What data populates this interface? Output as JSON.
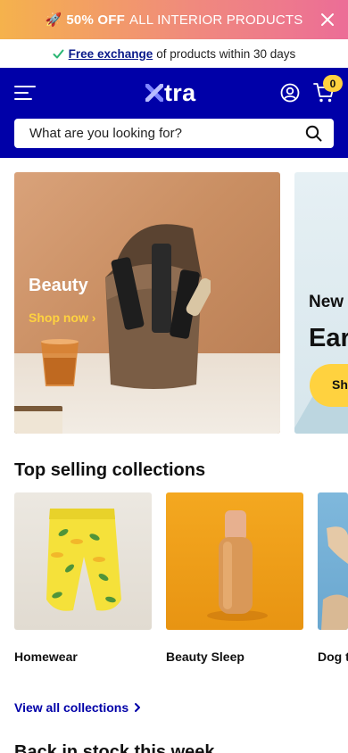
{
  "promo": {
    "icon": "rocket-icon",
    "highlight": "50% OFF",
    "text": "ALL INTERIOR PRODUCTS",
    "gradient_start": "#f5b24c",
    "gradient_end": "#ec6d97"
  },
  "exchange": {
    "link": "Free exchange",
    "text": "of products within 30 days",
    "check_color": "#2bb673"
  },
  "header": {
    "background": "#0000a8",
    "logo_text": "tra",
    "cart_count": "0",
    "search_placeholder": "What are you looking for?"
  },
  "hero": {
    "title": "Beauty",
    "link": "Shop now",
    "next_slide": {
      "title": "New",
      "headline": "Ear",
      "button": "Sh"
    }
  },
  "collections": {
    "title": "Top selling collections",
    "items": [
      {
        "label": "Homewear"
      },
      {
        "label": "Beauty Sleep"
      },
      {
        "label": "Dog t"
      }
    ],
    "view_all": "View all collections"
  },
  "next_section": {
    "title": "Back in stock this week"
  }
}
